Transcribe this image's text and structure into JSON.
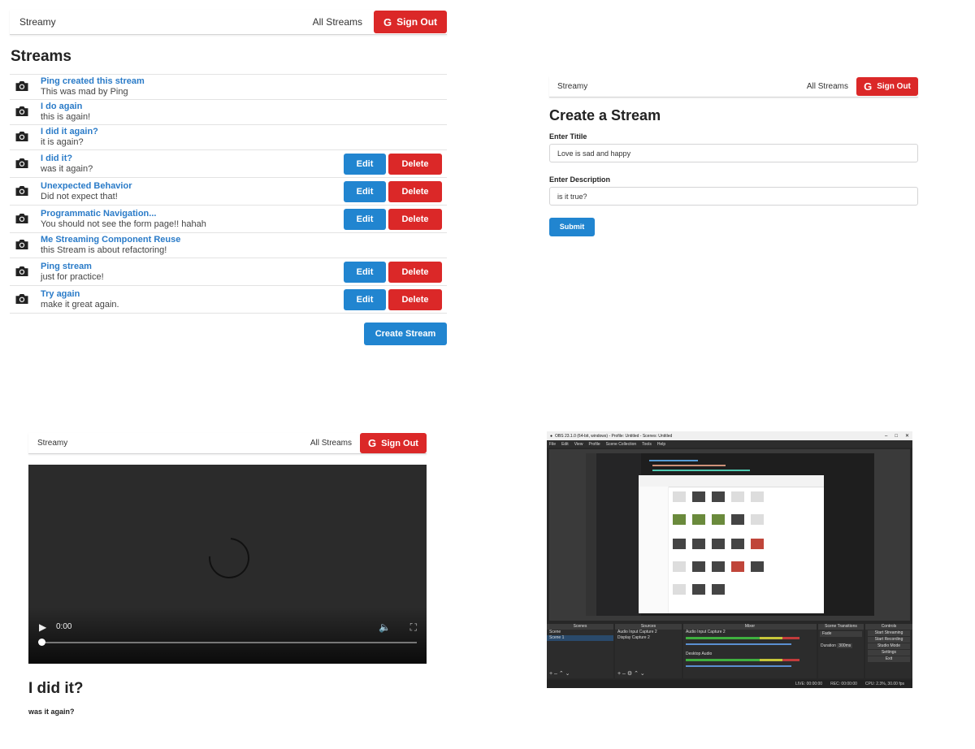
{
  "list_page": {
    "brand": "Streamy",
    "all_streams": "All Streams",
    "sign_out": "Sign Out",
    "heading": "Streams",
    "streams": [
      {
        "title": "Ping created this stream",
        "description": "This was mad by Ping",
        "owned": false
      },
      {
        "title": "I do again",
        "description": "this is again!",
        "owned": false
      },
      {
        "title": "I did it again?",
        "description": "it is again?",
        "owned": false
      },
      {
        "title": "I did it?",
        "description": "was it again?",
        "owned": true
      },
      {
        "title": "Unexpected Behavior",
        "description": "Did not expect that!",
        "owned": true
      },
      {
        "title": "Programmatic Navigation...",
        "description": "You should not see the form page!! hahah",
        "owned": true
      },
      {
        "title": "Me Streaming Component Reuse",
        "description": "this Stream is about refactoring!",
        "owned": false
      },
      {
        "title": "Ping stream",
        "description": "just for practice!",
        "owned": true
      },
      {
        "title": "Try again",
        "description": "make it great again.",
        "owned": true
      }
    ],
    "edit_label": "Edit",
    "delete_label": "Delete",
    "create_button": "Create Stream"
  },
  "create_page": {
    "brand": "Streamy",
    "all_streams": "All Streams",
    "sign_out": "Sign Out",
    "heading": "Create a Stream",
    "title_label": "Enter Titile",
    "title_value": "Love is sad and happy",
    "description_label": "Enter Description",
    "description_value": "is it true?",
    "submit": "Submit"
  },
  "show_page": {
    "brand": "Streamy",
    "all_streams": "All Streams",
    "sign_out": "Sign Out",
    "video": {
      "time": "0:00",
      "progress": 0
    },
    "title": "I did it?",
    "description": "was it again?"
  },
  "obs": {
    "window_title": "OBS 23.1.0 (64-bit, windows) - Profile: Untitled - Scenes: Untitled",
    "menu": [
      "File",
      "Edit",
      "View",
      "Profile",
      "Scene Collection",
      "Tools",
      "Help"
    ],
    "docks": {
      "scenes": {
        "header": "Scenes",
        "items": [
          "Scene",
          "Scene 1"
        ]
      },
      "sources": {
        "header": "Sources",
        "items": [
          "Audio Input Capture 2",
          "Display Capture 2"
        ]
      },
      "mixer": {
        "header": "Mixer",
        "channels": [
          "Audio Input Capture 2",
          "Desktop Audio"
        ],
        "db": "0.0 dB"
      },
      "transitions": {
        "header": "Scene Transitions",
        "type": "Fade",
        "duration_label": "Duration",
        "duration": "300ms"
      },
      "controls": {
        "header": "Controls",
        "buttons": [
          "Start Streaming",
          "Start Recording",
          "Studio Mode",
          "Settings",
          "Exit"
        ]
      }
    },
    "status": {
      "live": "LIVE: 00:00:00",
      "rec": "REC: 00:00:00",
      "cpu": "CPU: 2.3%, 30.00 fps"
    }
  },
  "colors": {
    "primary": "#2185d0",
    "danger": "#db2828",
    "link": "#2a7bc8"
  },
  "icons": {
    "row": "camera-icon",
    "sign_out": "google-icon"
  }
}
